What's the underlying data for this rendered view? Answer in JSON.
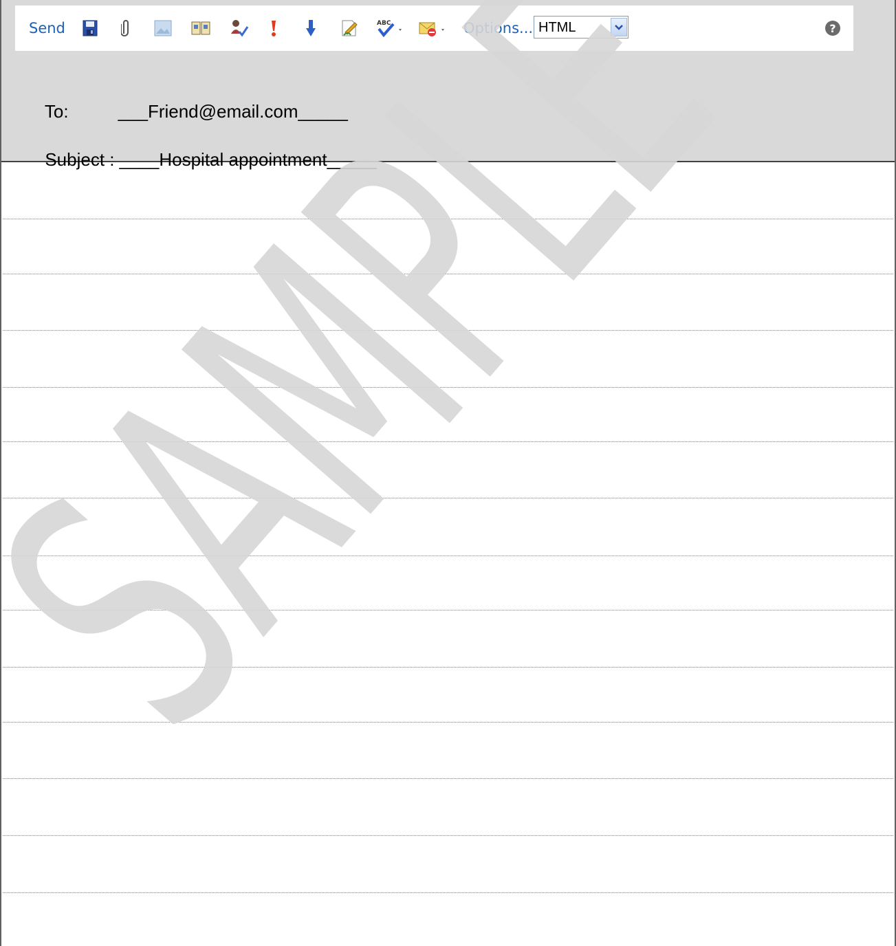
{
  "toolbar": {
    "send_label": "Send",
    "options_label": "Options...",
    "format_select": {
      "value": "HTML"
    },
    "icons": [
      "save-icon",
      "attach-icon",
      "insert-image-icon",
      "address-book-icon",
      "check-names-icon",
      "high-importance-icon",
      "low-importance-icon",
      "signature-icon",
      "spell-check-icon",
      "flag-icon",
      "help-icon"
    ]
  },
  "header": {
    "to_label": "To:",
    "to_value": "___Friend@email.com_____",
    "subject_label": "Subject :",
    "subject_value": "____Hospital appointment_____"
  },
  "watermark": {
    "text": "SAMPLE"
  },
  "colors": {
    "link": "#1a62b8",
    "header_bg": "#d9d9d9",
    "watermark": "#d6d6d6"
  }
}
